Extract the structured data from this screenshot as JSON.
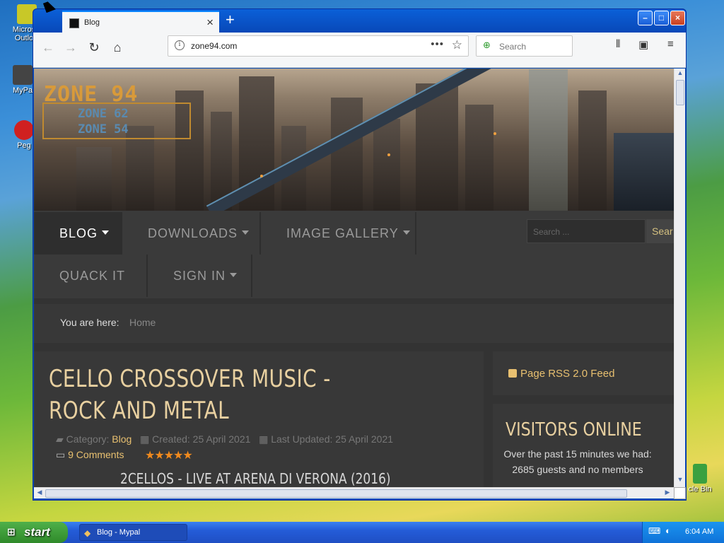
{
  "desktop": {
    "icons": [
      {
        "label": "Micros Outlo",
        "color": "#c8c828"
      },
      {
        "label": "MyPa",
        "color": "#444444"
      },
      {
        "label": "Peg",
        "color": "#d02020"
      },
      {
        "label": "cle Bin",
        "color": "#3aa040"
      }
    ]
  },
  "browser": {
    "tab": {
      "title": "Blog"
    },
    "address": {
      "url": "zone94.com"
    },
    "search": {
      "placeholder": "Search"
    },
    "controls": {
      "minimize": "–",
      "maximize": "□",
      "close": "×"
    },
    "nav_icons": [
      "back-icon",
      "forward-icon",
      "reload-icon",
      "home-icon"
    ]
  },
  "page": {
    "logo": {
      "line1": "ZONE 94",
      "line2": "ZONE 62",
      "line3": "ZONE 54"
    },
    "menu": [
      {
        "label": "BLOG",
        "active": true
      },
      {
        "label": "DOWNLOADS",
        "active": false
      },
      {
        "label": "IMAGE GALLERY",
        "active": false
      },
      {
        "label": "QUACK IT",
        "active": false
      },
      {
        "label": "SIGN IN",
        "active": false
      }
    ],
    "menu_search": {
      "placeholder": "Search ...",
      "button": "Sear"
    },
    "breadcrumb": {
      "label": "You are here:",
      "home": "Home"
    },
    "article": {
      "title": "CELLO CROSSOVER MUSIC - ROCK AND METAL",
      "category_label": "Category:",
      "category": "Blog",
      "created": "Created: 25 April 2021",
      "updated": "Last Updated: 25 April 2021",
      "comments": "9 Comments",
      "rating": 5,
      "subtitle": "2CELLOS - LIVE AT ARENA DI VERONA (2016)"
    },
    "sidebar": {
      "rss": "Page RSS 2.0 Feed",
      "visitors_title": "VISITORS ONLINE",
      "visitors_text": "Over the past 15 minutes we had: 2685 guests and no members"
    }
  },
  "taskbar": {
    "start": "start",
    "task": "Blog - Mypal",
    "clock": "6:04 AM"
  },
  "colors": {
    "accent": "#e8c070",
    "title_gold": "#e8d0a0",
    "star_orange": "#f08a1e",
    "xp_blue": "#245cd8",
    "start_green": "#2f8a2a"
  }
}
